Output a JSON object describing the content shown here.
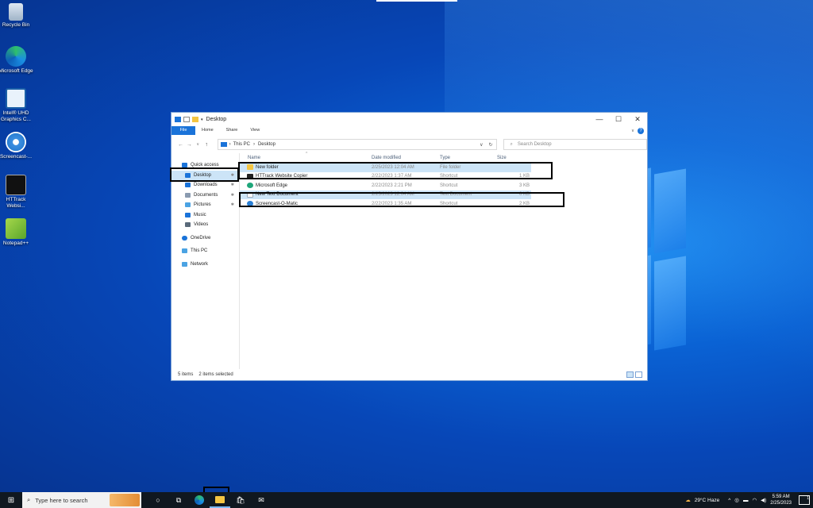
{
  "desktop": {
    "icons": [
      {
        "label": "Recycle Bin",
        "icon": "recycle-bin-icon"
      },
      {
        "label": "Microsoft Edge",
        "icon": "edge-icon"
      },
      {
        "label": "Intel® UHD Graphics C...",
        "icon": "intel-graphics-icon"
      },
      {
        "label": "Screencast-...",
        "icon": "screencast-icon"
      },
      {
        "label": "HTTrack Websi...",
        "icon": "httrack-icon"
      },
      {
        "label": "Notepad++",
        "icon": "notepad-plus-plus-icon"
      }
    ]
  },
  "window": {
    "title": "Desktop",
    "controls": {
      "minimize": "—",
      "maximize": "☐",
      "close": "✕"
    },
    "ribbon_tabs": [
      "File",
      "Home",
      "Share",
      "View"
    ],
    "breadcrumb": [
      "This PC",
      "Desktop"
    ],
    "search_placeholder": "Search Desktop",
    "nav": [
      {
        "label": "Quick access",
        "icon": "star-icon",
        "color": "#1a73d9",
        "level": 0,
        "pinned": false
      },
      {
        "label": "Desktop",
        "icon": "desktop-folder-icon",
        "color": "#1a73d9",
        "level": 1,
        "pinned": true,
        "selected": true
      },
      {
        "label": "Downloads",
        "icon": "download-icon",
        "color": "#1a73d9",
        "level": 1,
        "pinned": true
      },
      {
        "label": "Documents",
        "icon": "documents-icon",
        "color": "#8a9bb0",
        "level": 1,
        "pinned": true
      },
      {
        "label": "Pictures",
        "icon": "pictures-icon",
        "color": "#4ba3e3",
        "level": 1,
        "pinned": true
      },
      {
        "label": "Music",
        "icon": "music-icon",
        "color": "#1a73d9",
        "level": 1,
        "pinned": false
      },
      {
        "label": "Videos",
        "icon": "videos-icon",
        "color": "#5a6a7a",
        "level": 1,
        "pinned": false
      },
      {
        "label": "OneDrive",
        "icon": "cloud-icon",
        "color": "#1a73d9",
        "level": 0,
        "pinned": false
      },
      {
        "label": "This PC",
        "icon": "computer-icon",
        "color": "#4ba3e3",
        "level": 0,
        "pinned": false
      },
      {
        "label": "Network",
        "icon": "network-icon",
        "color": "#4ba3e3",
        "level": 0,
        "pinned": false
      }
    ],
    "columns": {
      "name": "Name",
      "date": "Date modified",
      "type": "Type",
      "size": "Size"
    },
    "files": [
      {
        "name": "New folder",
        "date": "2/25/2023 12:04 AM",
        "type": "File folder",
        "size": "",
        "icon": "folder-icon",
        "color": "#f4c542",
        "selected": true
      },
      {
        "name": "HTTrack Website Copier",
        "date": "2/22/2023 1:37 AM",
        "type": "Shortcut",
        "size": "1 KB",
        "icon": "httrack-icon",
        "color": "#222222",
        "selected": false
      },
      {
        "name": "Microsoft Edge",
        "date": "2/22/2023 2:21 PM",
        "type": "Shortcut",
        "size": "3 KB",
        "icon": "edge-icon",
        "color": "#1fa67a",
        "selected": false
      },
      {
        "name": "New Text Document",
        "date": "2/25/2023 12:04 AM",
        "type": "Text Document",
        "size": "0 KB",
        "icon": "text-file-icon",
        "color": "#c9d3de",
        "selected": true
      },
      {
        "name": "Screencast-O-Matic",
        "date": "2/22/2023 1:35 AM",
        "type": "Shortcut",
        "size": "2 KB",
        "icon": "screencast-icon",
        "color": "#2a7fd4",
        "selected": false
      }
    ],
    "status": {
      "count": "5 items",
      "selected": "2 items selected"
    }
  },
  "taskbar": {
    "search_placeholder": "Type here to search",
    "weather": "29°C  Haze",
    "time": "5:59 AM",
    "date": "2/25/2023",
    "notifications": "1"
  }
}
